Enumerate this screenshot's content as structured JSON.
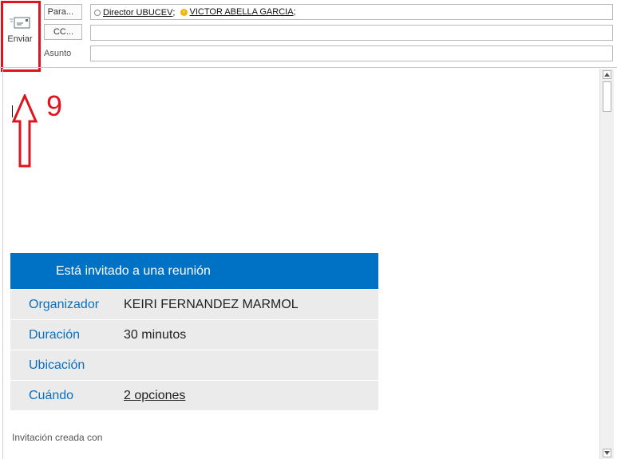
{
  "toolbar": {
    "send_label": "Enviar",
    "send_icon": "send-envelope-icon"
  },
  "header": {
    "to_button": "Para...",
    "cc_button": "CC...",
    "subject_label": "Asunto",
    "recipients": [
      {
        "name": "Director UBUCEV",
        "separator": ";",
        "status_icon": "presence-unknown-icon"
      },
      {
        "name": "VICTOR ABELLA GARCIA",
        "separator": ";",
        "status_icon": "presence-away-clock-icon"
      }
    ],
    "cc_value": "",
    "subject_value": ""
  },
  "annotation": {
    "number": "9",
    "color": "#e0141e"
  },
  "invite": {
    "header": "Está invitado a una reunión",
    "accent_color": "#0072c6",
    "rows": [
      {
        "label": "Organizador",
        "value": "KEIRI FERNANDEZ MARMOL"
      },
      {
        "label": "Duración",
        "value": "30 minutos"
      },
      {
        "label": "Ubicación",
        "value": ""
      },
      {
        "label": "Cuándo",
        "value": "2 opciones"
      }
    ]
  },
  "footer": {
    "text": "Invitación creada con"
  }
}
